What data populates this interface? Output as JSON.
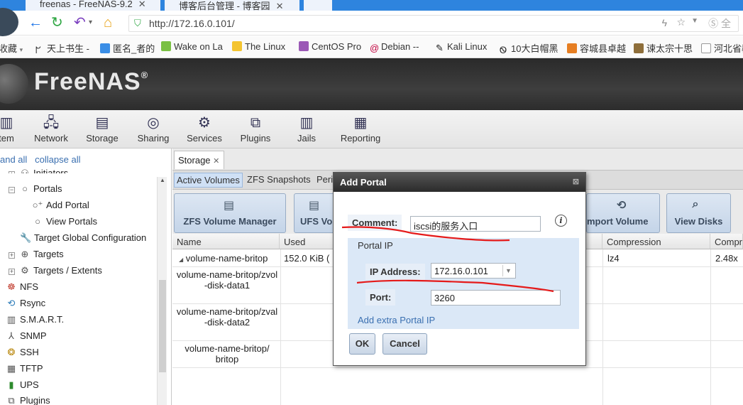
{
  "browser": {
    "tabs": [
      {
        "title": "freenas - FreeNAS-9.2"
      },
      {
        "title": "博客后台管理 - 博客园"
      }
    ],
    "url": "http://172.16.0.101/",
    "bookmarks": [
      "收藏",
      "天上书生 -",
      "匿名_者的",
      "Wake on La",
      "The Linux",
      "CentOS Pro",
      "Debian --",
      "Kali Linux",
      "10大白帽黑",
      "容城县卓越",
      "谏太宗十思",
      "河北省教"
    ]
  },
  "app": {
    "logo": "FreeNAS",
    "toolbar": [
      "tem",
      "Network",
      "Storage",
      "Sharing",
      "Services",
      "Plugins",
      "Jails",
      "Reporting"
    ]
  },
  "tree": {
    "expand_all": "and all",
    "collapse_all": "collapse all",
    "items": [
      "Initiators",
      "Portals",
      "Add Portal",
      "View Portals",
      "Target Global Configuration",
      "Targets",
      "Targets / Extents",
      "NFS",
      "Rsync",
      "S.M.A.R.T.",
      "SNMP",
      "SSH",
      "TFTP",
      "UPS",
      "Plugins"
    ]
  },
  "main": {
    "tab": "Storage",
    "subtabs": [
      "Active Volumes",
      "ZFS Snapshots",
      "Peri"
    ],
    "buttons": [
      "ZFS Volume Manager",
      "UFS Vo",
      "mport Volume",
      "View Disks"
    ],
    "columns": [
      "Name",
      "Used",
      "Compression",
      "Compr"
    ],
    "rows": [
      {
        "name": "volume-name-britop",
        "used": "152.0 KiB (",
        "compression": "lz4",
        "ratio": "2.48x"
      },
      {
        "name": "volume-name-britop/zvol-disk-data1",
        "used": "",
        "compression": "",
        "ratio": ""
      },
      {
        "name": "volume-name-britop/zval-disk-data2",
        "used": "",
        "compression": "",
        "ratio": ""
      },
      {
        "name": "volume-name-britop/britop",
        "used": "",
        "compression": "",
        "ratio": ""
      }
    ]
  },
  "dialog": {
    "title": "Add Portal",
    "comment_label": "Comment:",
    "comment_value": "iscsi的服务入口",
    "portal_ip_label": "Portal IP",
    "ip_label": "IP Address:",
    "ip_value": "172.16.0.101",
    "port_label": "Port:",
    "port_value": "3260",
    "add_extra": "Add extra Portal IP",
    "ok": "OK",
    "cancel": "Cancel"
  }
}
